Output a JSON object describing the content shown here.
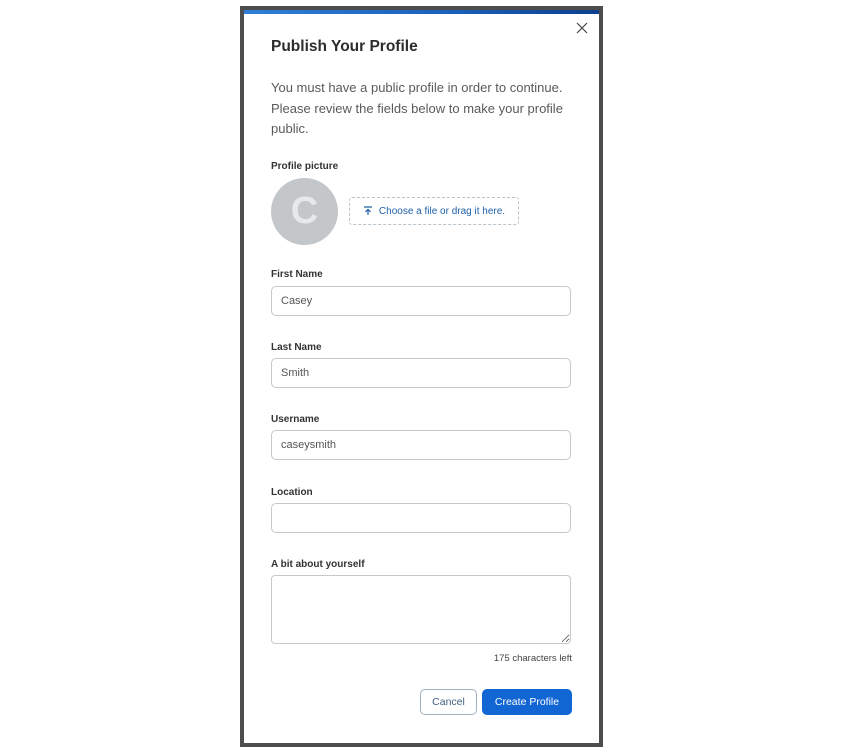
{
  "modal": {
    "title": "Publish Your Profile",
    "close_icon": "close-icon",
    "description": "You must have a public profile in order to continue. Please review the fields below to make your profile public.",
    "accent_color": "#1266d3"
  },
  "profile_picture": {
    "label": "Profile picture",
    "avatar_initial": "C",
    "upload_icon": "upload-icon",
    "upload_label": "Choose a file or drag it here."
  },
  "fields": {
    "first_name": {
      "label": "First Name",
      "value": "Casey"
    },
    "last_name": {
      "label": "Last Name",
      "value": "Smith"
    },
    "username": {
      "label": "Username",
      "value": "caseysmith"
    },
    "location": {
      "label": "Location",
      "value": ""
    },
    "about": {
      "label": "A bit about yourself",
      "value": "",
      "counter": "175 characters left"
    }
  },
  "actions": {
    "cancel_label": "Cancel",
    "create_label": "Create Profile"
  }
}
